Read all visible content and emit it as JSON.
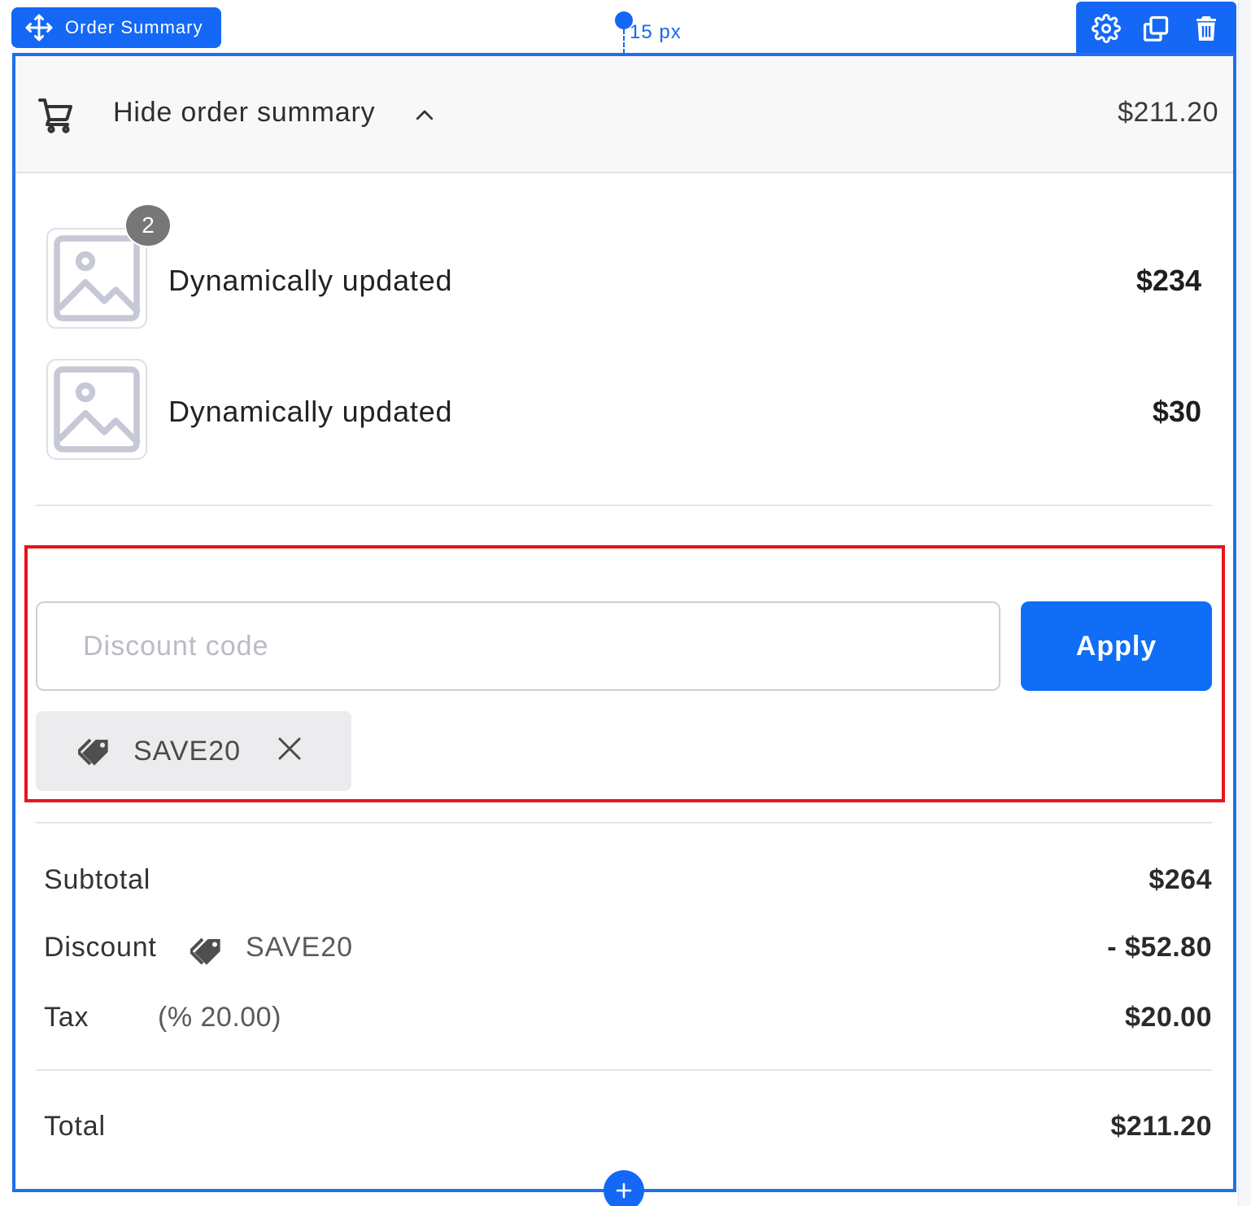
{
  "editor": {
    "block_name": "Order Summary",
    "spacing_label": "15 px",
    "toolbar": {
      "settings_icon": "gear-icon",
      "duplicate_icon": "duplicate-icon",
      "delete_icon": "trash-icon"
    },
    "add_icon": "plus-icon",
    "accent_color": "#1468f5"
  },
  "summary_header": {
    "toggle_label": "Hide order summary",
    "total": "$211.20",
    "cart_icon": "cart-icon",
    "chevron_icon": "chevron-up-icon"
  },
  "line_items": [
    {
      "name": "Dynamically updated",
      "price": "$234",
      "quantity": "2",
      "image_icon": "image-placeholder-icon"
    },
    {
      "name": "Dynamically updated",
      "price": "$30",
      "quantity": null,
      "image_icon": "image-placeholder-icon"
    }
  ],
  "discount": {
    "input_placeholder": "Discount code",
    "input_value": "",
    "apply_label": "Apply",
    "applied_code": "SAVE20",
    "highlight_color": "#e8141b"
  },
  "totals": {
    "subtotal_label": "Subtotal",
    "subtotal_value": "$264",
    "discount_label": "Discount",
    "discount_code": "SAVE20",
    "discount_value": "- $52.80",
    "tax_label": "Tax",
    "tax_rate": "(% 20.00)",
    "tax_value": "$20.00",
    "total_label": "Total",
    "total_value": "$211.20"
  }
}
